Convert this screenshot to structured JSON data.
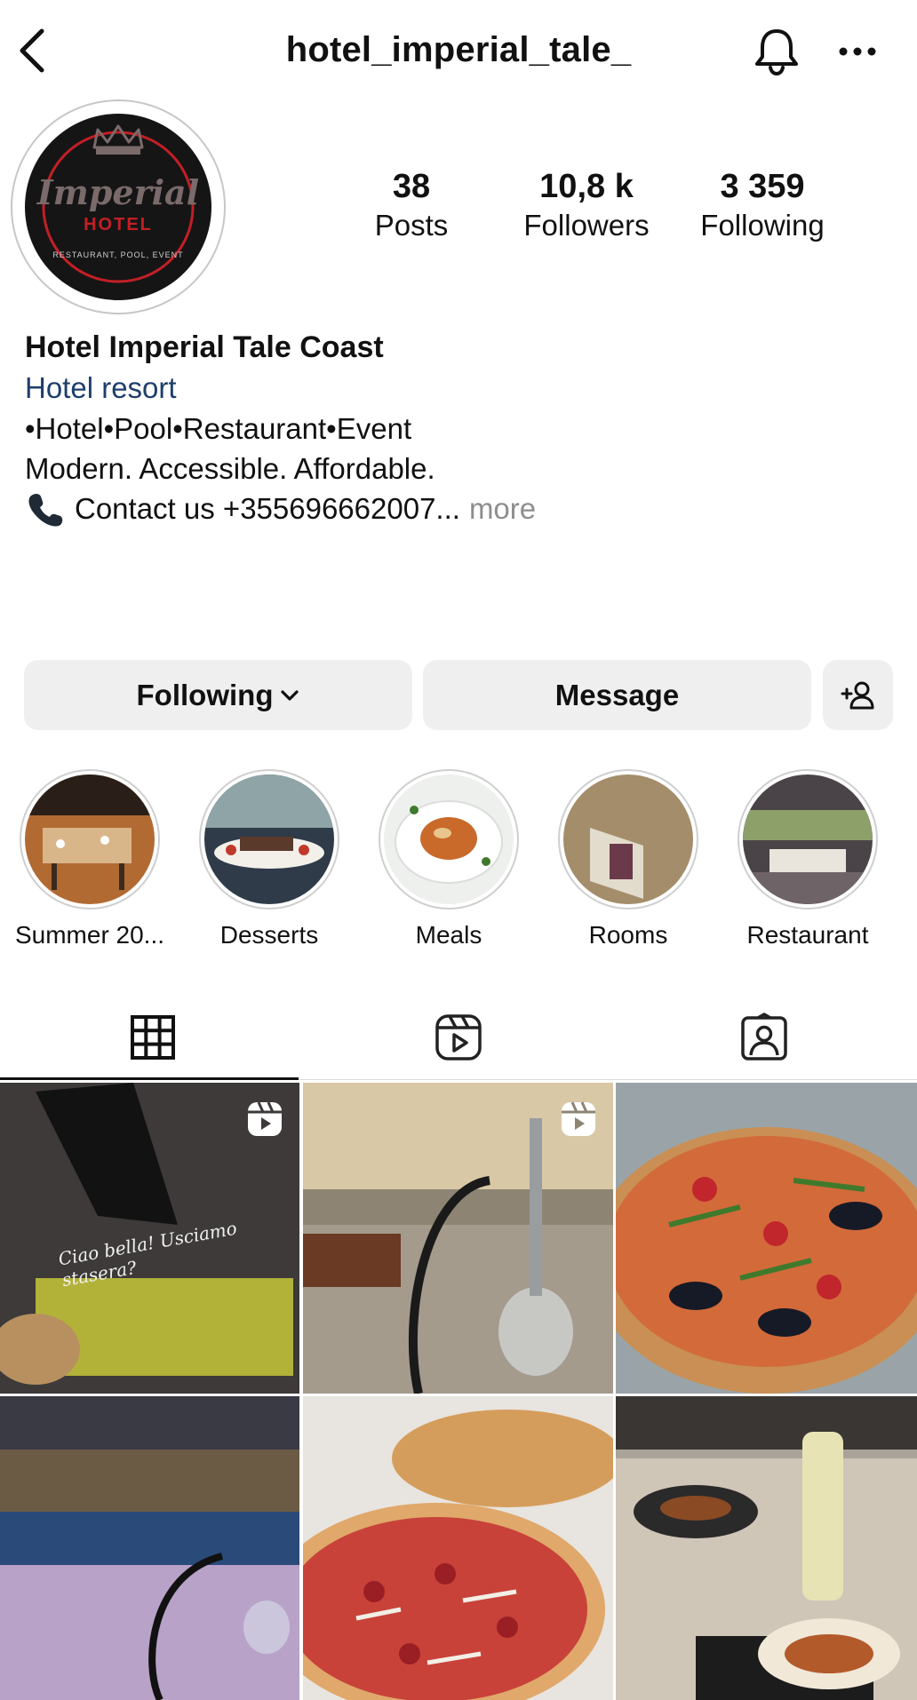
{
  "header": {
    "username": "hotel_imperial_tale_",
    "back_icon": "chevron-left-icon",
    "notifications_icon": "bell-icon",
    "options_icon": "ellipsis-icon"
  },
  "profile": {
    "avatar": {
      "logo_text": "Imperial",
      "logo_subtext": "HOTEL",
      "logo_ring_text": "RESTAURANT, POOL, EVENT",
      "colors": {
        "ring": "#c21f26",
        "background": "#151515"
      }
    },
    "stats": [
      {
        "value": "38",
        "label": "Posts"
      },
      {
        "value": "10,8 k",
        "label": "Followers"
      },
      {
        "value": "3 359",
        "label": "Following"
      }
    ],
    "bio": {
      "name": "Hotel Imperial Tale Coast",
      "category": "Hotel resort",
      "line1": "•Hotel•Pool•Restaurant•Event",
      "line2": "Modern. Accessible. Affordable.",
      "contact": "Contact us +355696662007...",
      "more": "more"
    }
  },
  "actions": {
    "following_label": "Following",
    "message_label": "Message",
    "add_user_icon": "add-user-icon"
  },
  "highlights": [
    {
      "label": "Summer 20..."
    },
    {
      "label": "Desserts"
    },
    {
      "label": "Meals"
    },
    {
      "label": "Rooms"
    },
    {
      "label": "Restaurant"
    }
  ],
  "tabs": [
    {
      "icon": "grid-icon",
      "active": true
    },
    {
      "icon": "reels-icon",
      "active": false
    },
    {
      "icon": "tagged-icon",
      "active": false
    }
  ],
  "posts": [
    {
      "type": "reel",
      "overlay_text": "Ciao bella! Usciamo stasera?"
    },
    {
      "type": "reel"
    },
    {
      "type": "photo"
    },
    {
      "type": "photo"
    },
    {
      "type": "photo"
    },
    {
      "type": "photo"
    }
  ],
  "colors": {
    "category_link": "#1e3f6b",
    "button_bg": "#efefef",
    "muted_text": "#8e8e8e"
  }
}
